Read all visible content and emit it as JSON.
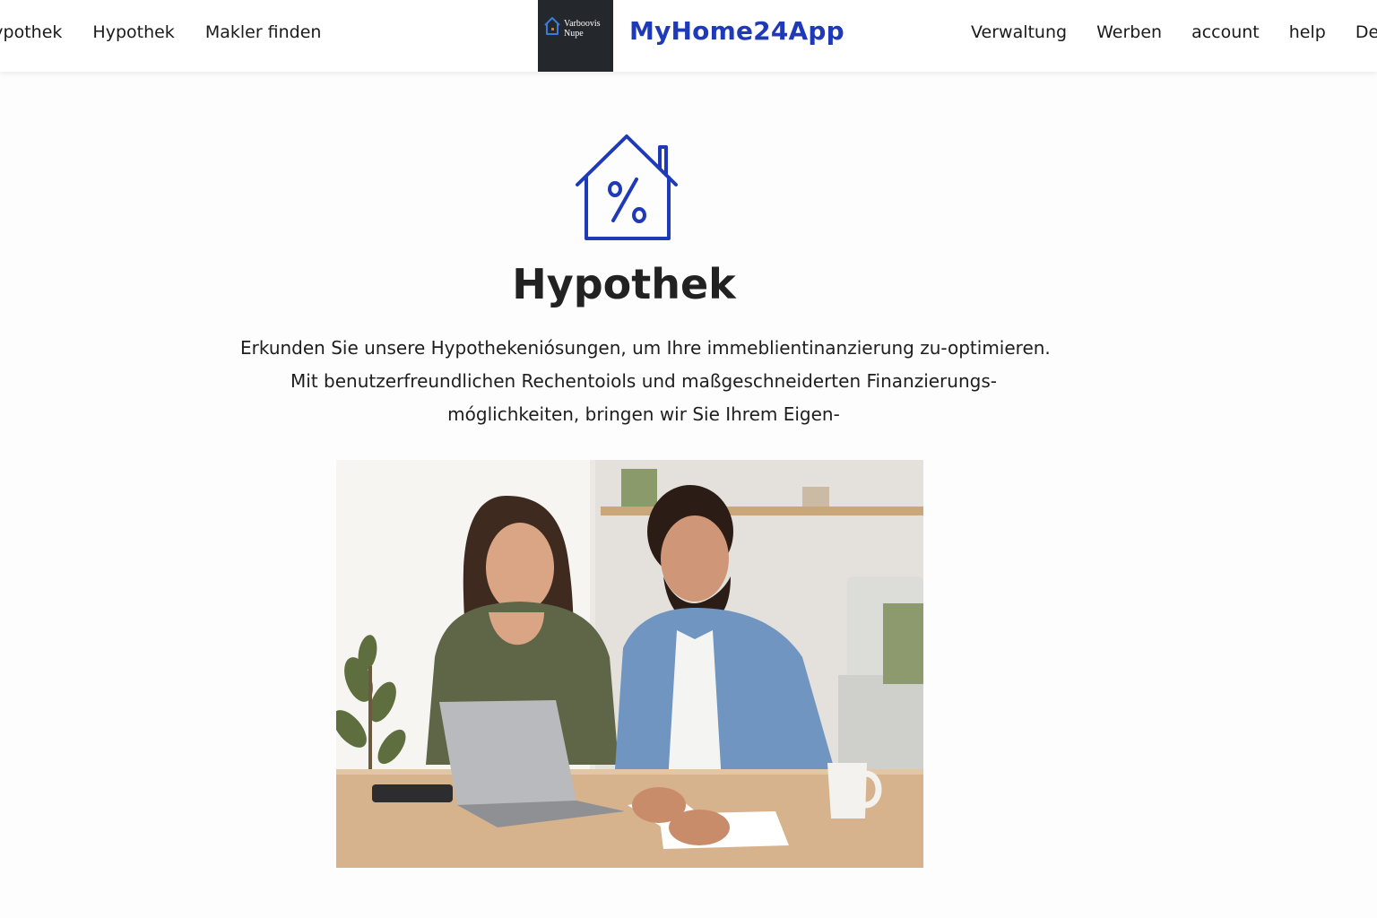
{
  "header": {
    "nav_left": [
      {
        "label": "Hypothek"
      },
      {
        "label": "Hypothek"
      },
      {
        "label": "Makler finden"
      }
    ],
    "logo_lines": [
      "Varboovis",
      "Nupe"
    ],
    "brand": "MyHome24App",
    "brand_color": "#1f3ab8",
    "nav_right": [
      {
        "label": "Verwaltung"
      },
      {
        "label": "Werben"
      },
      {
        "label": "account"
      },
      {
        "label": "help"
      },
      {
        "label": "Deutsch"
      }
    ]
  },
  "hero": {
    "icon": "house-percent-icon",
    "title": "Hypothek",
    "text_lines": [
      "Erkunden Sie unsere Hypothekeniósungen, um Ihre immeblientinanzierung zu-optimieren.",
      "Mit benutzerfreundlichen Rechentoiols und maßgeschneiderten Finanzierungs-",
      "móglichkeiten, bringen wir Sie Ihrem Eigen-"
    ],
    "image": "couple-at-laptop-photo"
  }
}
